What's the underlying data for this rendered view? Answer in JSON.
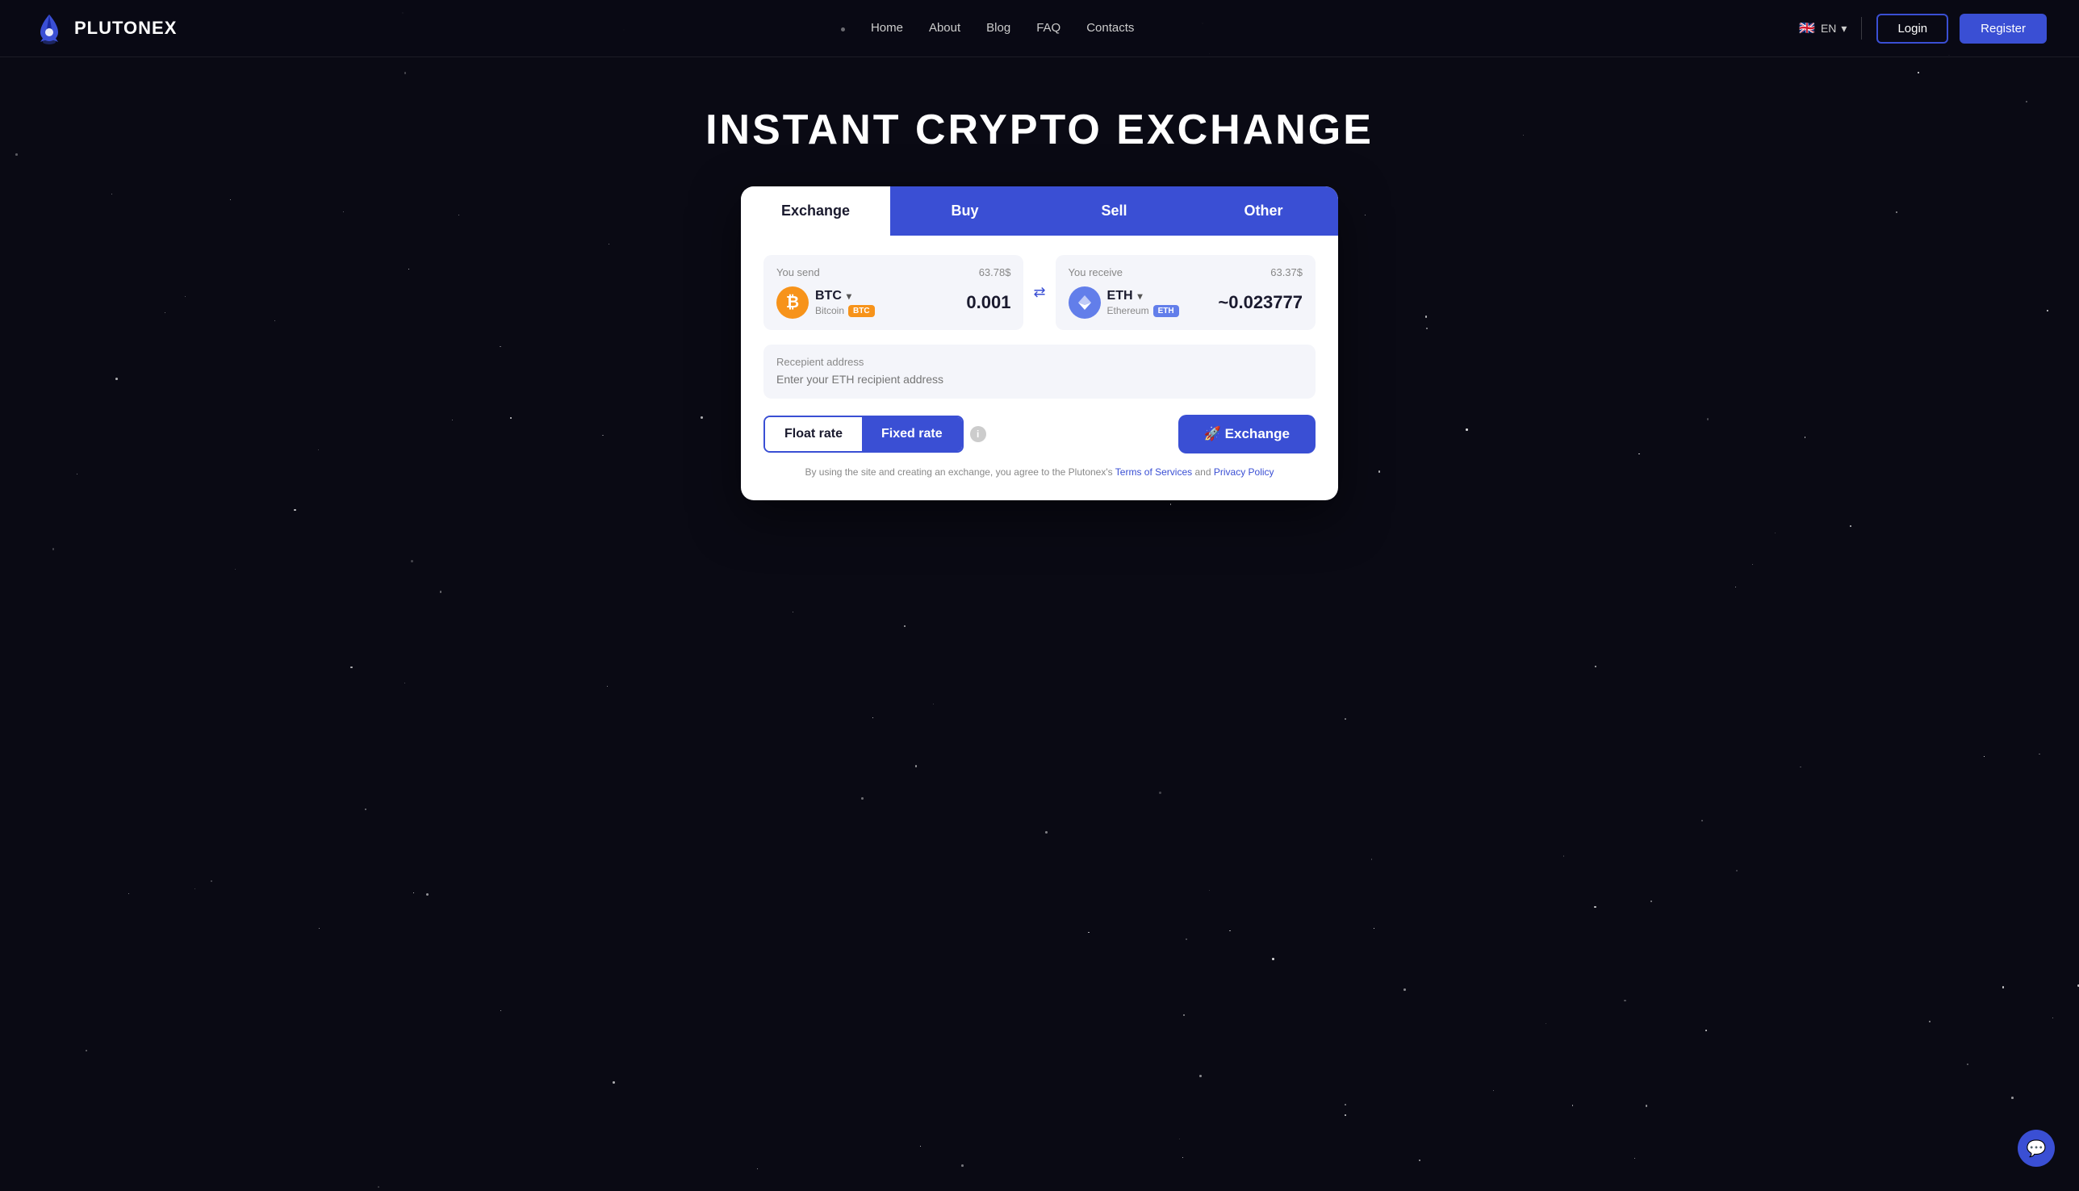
{
  "brand": {
    "name": "PLUTONEX"
  },
  "nav": {
    "links": [
      {
        "label": "Home",
        "href": "#"
      },
      {
        "label": "About",
        "href": "#"
      },
      {
        "label": "Blog",
        "href": "#"
      },
      {
        "label": "FAQ",
        "href": "#"
      },
      {
        "label": "Contacts",
        "href": "#"
      }
    ],
    "language": "EN",
    "login_label": "Login",
    "register_label": "Register"
  },
  "hero": {
    "title": "INSTANT CRYPTO EXCHANGE"
  },
  "exchange_card": {
    "tabs": [
      {
        "id": "exchange",
        "label": "Exchange",
        "active": true
      },
      {
        "id": "buy",
        "label": "Buy",
        "active": false
      },
      {
        "id": "sell",
        "label": "Sell",
        "active": false
      },
      {
        "id": "other",
        "label": "Other",
        "active": false
      }
    ],
    "send_field": {
      "label": "You send",
      "usd_value": "63.78$",
      "crypto_symbol": "BTC",
      "crypto_name": "Bitcoin",
      "amount": "0.001"
    },
    "receive_field": {
      "label": "You receive",
      "usd_value": "63.37$",
      "crypto_symbol": "ETH",
      "crypto_name": "Ethereum",
      "amount": "~0.023777"
    },
    "recipient": {
      "label": "Recepient address",
      "placeholder": "Enter your ETH recipient address"
    },
    "float_rate_label": "Float rate",
    "fixed_rate_label": "Fixed rate",
    "exchange_button_label": "🚀 Exchange",
    "terms_text_before": "By using the site and creating an exchange, you agree to the Plutonex's",
    "terms_of_service_label": "Terms of Services",
    "terms_and": "and",
    "privacy_policy_label": "Privacy Policy"
  },
  "chat": {
    "icon": "💬"
  }
}
